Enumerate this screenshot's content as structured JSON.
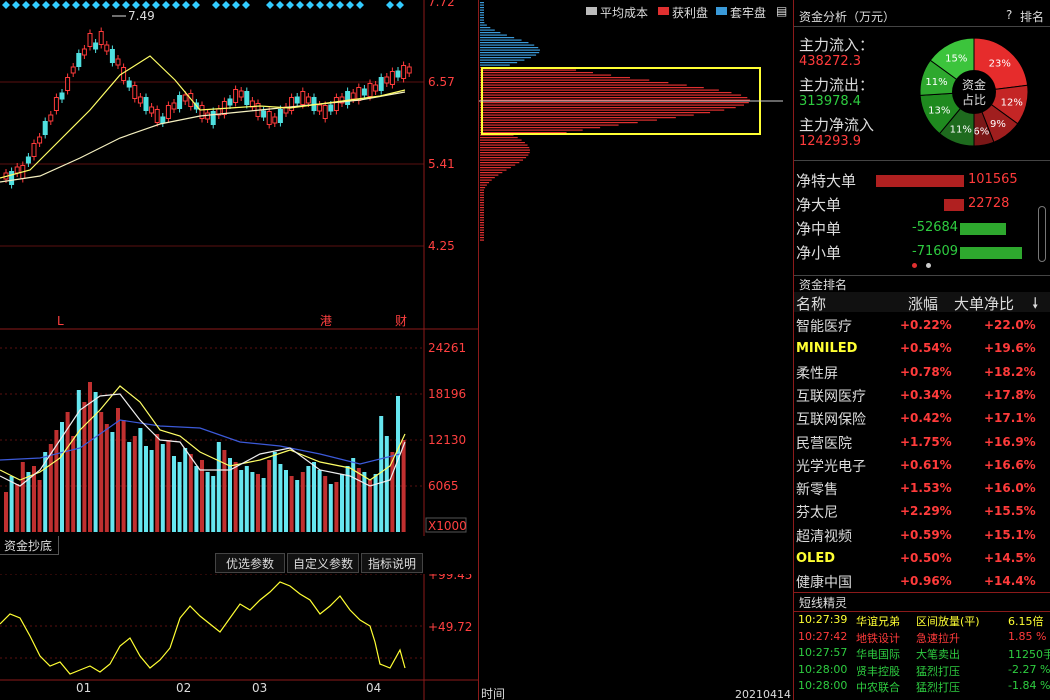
{
  "main_chart": {
    "price_ticks": [
      "7.72",
      "6.57",
      "5.41",
      "4.25"
    ],
    "high_label": "7.49",
    "markers": [
      "L",
      "港",
      "财"
    ]
  },
  "volume_chart": {
    "ticks": [
      "24261",
      "18196",
      "12130",
      "6065"
    ],
    "unit": "X1000"
  },
  "indicator": {
    "title": "资金抄底",
    "buttons": [
      "优选参数",
      "自定义参数",
      "指标说明"
    ],
    "ticks": [
      "+99.45",
      "+49.72"
    ],
    "months": [
      "01",
      "02",
      "03",
      "04"
    ]
  },
  "chip": {
    "legend": [
      "平均成本",
      "获利盘",
      "套牢盘"
    ],
    "legend_colors": [
      "#bbbbbb",
      "#e03030",
      "#3a9ad9"
    ],
    "bottom_left": "时间",
    "bottom_right": "20210414"
  },
  "fund": {
    "title": "资金分析（万元）",
    "help": "?",
    "rank_link": "排名",
    "inflow_label": "主力流入：",
    "inflow_value": "438272.3",
    "outflow_label": "主力流出：",
    "outflow_value": "313978.4",
    "net_label": "主力净流入",
    "net_value": "124293.9",
    "donut_center": [
      "资金",
      "占比"
    ],
    "donut_slices": [
      {
        "label": "23%",
        "value": 23,
        "color": "#e62c2c"
      },
      {
        "label": "12%",
        "value": 12,
        "color": "#c42525"
      },
      {
        "label": "9%",
        "value": 9,
        "color": "#a01e1e"
      },
      {
        "label": "6%",
        "value": 6,
        "color": "#7a1717"
      },
      {
        "label": "11%",
        "value": 11,
        "color": "#1e6b1e"
      },
      {
        "label": "13%",
        "value": 13,
        "color": "#1f8a1f"
      },
      {
        "label": "11%",
        "value": 11,
        "color": "#2ea82e"
      },
      {
        "label": "15%",
        "value": 15,
        "color": "#3cc43c"
      }
    ],
    "nets": [
      {
        "label": "净特大单",
        "value": "101565",
        "bar": 101565
      },
      {
        "label": "净大单",
        "value": "22728",
        "bar": 22728
      },
      {
        "label": "净中单",
        "value": "-52684",
        "bar": -52684
      },
      {
        "label": "净小单",
        "value": "-71609",
        "bar": -71609
      }
    ]
  },
  "ranking": {
    "title": "资金排名",
    "headers": [
      "名称",
      "涨幅",
      "大单净比"
    ],
    "rows": [
      {
        "name": "智能医疗",
        "chg": "+0.22%",
        "ratio": "+22.0%"
      },
      {
        "name": "MINILED",
        "chg": "+0.54%",
        "ratio": "+19.6%"
      },
      {
        "name": "柔性屏",
        "chg": "+0.78%",
        "ratio": "+18.2%"
      },
      {
        "name": "互联网医疗",
        "chg": "+0.34%",
        "ratio": "+17.8%"
      },
      {
        "name": "互联网保险",
        "chg": "+0.42%",
        "ratio": "+17.1%"
      },
      {
        "name": "民营医院",
        "chg": "+1.75%",
        "ratio": "+16.9%"
      },
      {
        "name": "光学光电子",
        "chg": "+0.61%",
        "ratio": "+16.6%"
      },
      {
        "name": "新零售",
        "chg": "+1.53%",
        "ratio": "+16.0%"
      },
      {
        "name": "芬太尼",
        "chg": "+2.29%",
        "ratio": "+15.5%"
      },
      {
        "name": "超清视频",
        "chg": "+0.59%",
        "ratio": "+15.1%"
      },
      {
        "name": "OLED",
        "chg": "+0.50%",
        "ratio": "+14.5%"
      },
      {
        "name": "健康中国",
        "chg": "+0.96%",
        "ratio": "+14.4%"
      }
    ]
  },
  "shortline": {
    "title": "短线精灵",
    "rows": [
      {
        "time": "10:27:39",
        "name": "华谊兄弟",
        "event": "区间放量(平)",
        "val": "6.15倍",
        "color": "#ffff33"
      },
      {
        "time": "10:27:42",
        "name": "地铁设计",
        "event": "急速拉升",
        "val": "1.85 %",
        "color": "#ff3b3b"
      },
      {
        "time": "10:27:57",
        "name": "华电国际",
        "event": "大笔卖出",
        "val": "11250手",
        "color": "#2ecc40"
      },
      {
        "time": "10:28:00",
        "name": "贤丰控股",
        "event": "猛烈打压",
        "val": "-2.27 %",
        "color": "#2ecc40"
      },
      {
        "time": "10:28:00",
        "name": "中农联合",
        "event": "猛烈打压",
        "val": "-1.84 %",
        "color": "#2ecc40"
      }
    ]
  }
}
